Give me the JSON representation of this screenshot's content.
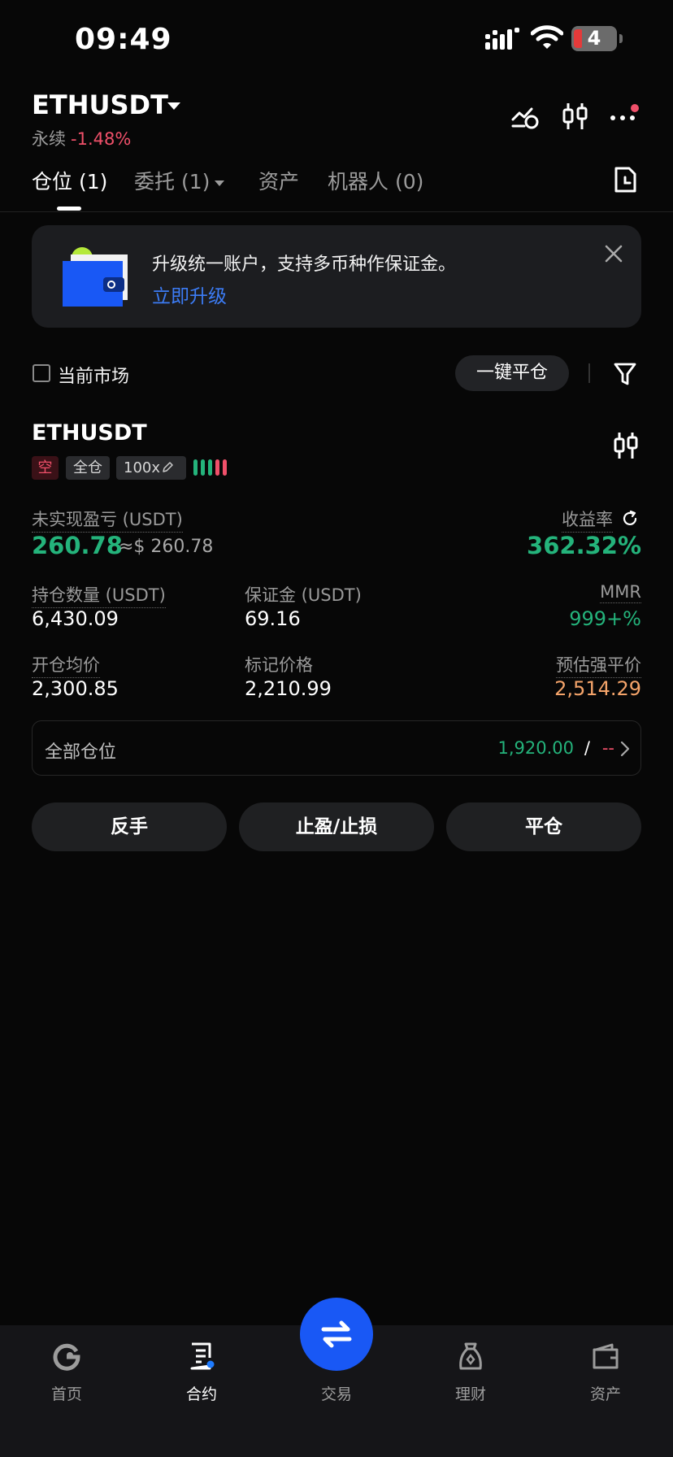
{
  "status_bar": {
    "time": "09:49",
    "battery": "4"
  },
  "header": {
    "pair": "ETHUSDT",
    "contract_type": "永续",
    "change": "-1.48%"
  },
  "tabs": [
    {
      "label": "仓位 (1)"
    },
    {
      "label": "委托 (1)"
    },
    {
      "label": "资产"
    },
    {
      "label": "机器人 (0)"
    }
  ],
  "banner": {
    "text": "升级统一账户，支持多币种作保证金。",
    "link": "立即升级"
  },
  "filter": {
    "current_market": "当前市场",
    "close_all": "一键平仓"
  },
  "position": {
    "symbol": "ETHUSDT",
    "side_tag": "空",
    "margin_tag": "全仓",
    "leverage": "100x",
    "unrealized_pnl_label": "未实现盈亏 (USDT)",
    "unrealized_pnl": "260.78",
    "unrealized_pnl_usd": "≈$ 260.78",
    "roe_label": "收益率",
    "roe": "362.32%",
    "size_label": "持仓数量 (USDT)",
    "size": "6,430.09",
    "margin_label": "保证金 (USDT)",
    "margin": "69.16",
    "mmr_label": "MMR",
    "mmr": "999+%",
    "entry_label": "开仓均价",
    "entry": "2,300.85",
    "mark_label": "标记价格",
    "mark": "2,210.99",
    "liq_label": "预估强平价",
    "liq": "2,514.29"
  },
  "all_positions": {
    "label": "全部仓位",
    "value": "1,920.00",
    "slash": "/",
    "other": "--"
  },
  "actions": {
    "reverse": "反手",
    "tpsl": "止盈/止损",
    "close": "平仓"
  },
  "bottom_nav": {
    "home": "首页",
    "futures": "合约",
    "trade": "交易",
    "earn": "理财",
    "assets": "资产"
  },
  "colors": {
    "accent_blue": "#1958f5",
    "green": "#24b37b",
    "red": "#f0506a",
    "orange": "#f5a46a"
  }
}
